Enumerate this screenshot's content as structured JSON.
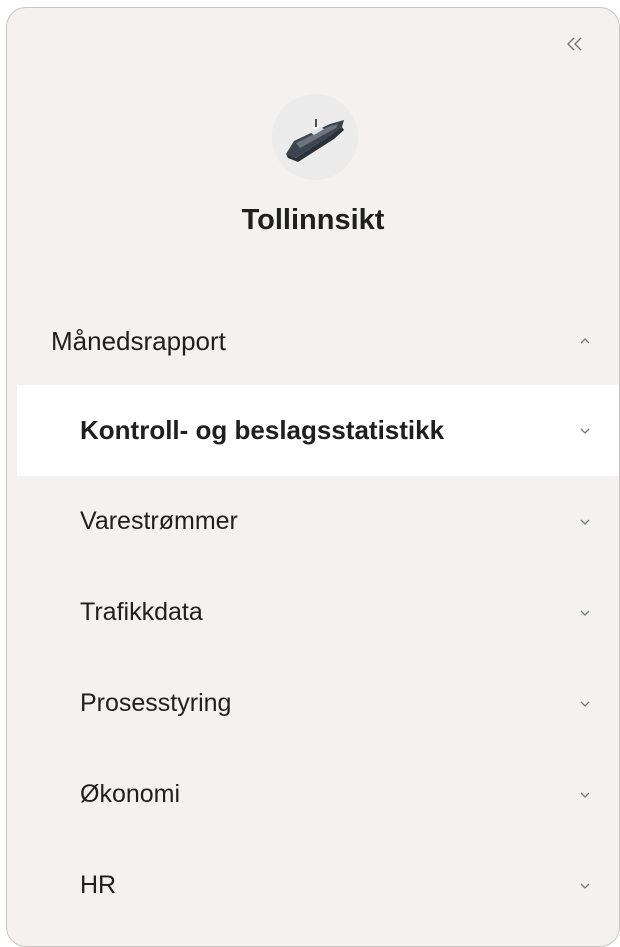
{
  "sidebar": {
    "collapse_icon": "double-chevron-left-icon",
    "logo_icon": "ship-icon",
    "app_title": "Tollinnsikt",
    "section": {
      "label": "Månedsrapport",
      "expanded": true,
      "chevron_icon": "chevron-up-icon"
    },
    "items": [
      {
        "label": "Kontroll- og beslagsstatistikk",
        "active": true,
        "chevron_icon": "chevron-down-icon"
      },
      {
        "label": "Varestrømmer",
        "active": false,
        "chevron_icon": "chevron-down-icon"
      },
      {
        "label": "Trafikkdata",
        "active": false,
        "chevron_icon": "chevron-down-icon"
      },
      {
        "label": "Prosesstyring",
        "active": false,
        "chevron_icon": "chevron-down-icon"
      },
      {
        "label": "Økonomi",
        "active": false,
        "chevron_icon": "chevron-down-icon"
      },
      {
        "label": "HR",
        "active": false,
        "chevron_icon": "chevron-down-icon"
      }
    ]
  },
  "colors": {
    "panel_background": "#f3f2f1",
    "active_item_background": "#ffffff",
    "text": "#1f1f1f",
    "icon": "#777777"
  }
}
